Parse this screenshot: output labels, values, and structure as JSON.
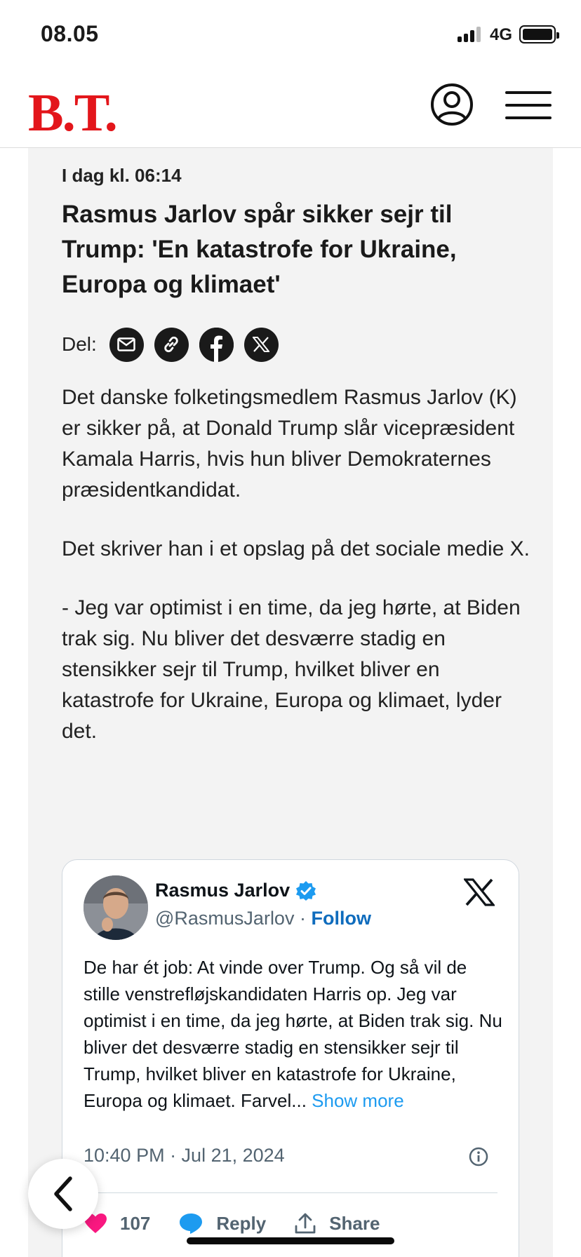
{
  "status_bar": {
    "time": "08.05",
    "network": "4G"
  },
  "header": {
    "logo": "B.T.",
    "brand_color": "#e3161b"
  },
  "article": {
    "timestamp": "I dag kl. 06:14",
    "headline": "Rasmus Jarlov spår sikker sejr til Trump: 'En katastrofe for Ukraine, Europa og klimaet'",
    "share_label": "Del:",
    "share_icons": [
      "mail-icon",
      "link-icon",
      "facebook-icon",
      "x-icon"
    ],
    "paragraphs": [
      "Det danske folketingsmedlem Rasmus Jarlov (K) er sikker på, at Donald Trump slår vicepræsident Kamala Harris, hvis hun bliver Demokraternes præsidentkandidat.",
      "Det skriver han i et opslag på det sociale medie X.",
      "- Jeg var optimist i en time, da jeg hørte, at Biden trak sig. Nu bliver det desværre stadig en stensikker sejr til Trump, hvilket bliver en katastrofe for Ukraine, Europa og klimaet, lyder det."
    ]
  },
  "tweet": {
    "name": "Rasmus Jarlov",
    "handle": "@RasmusJarlov",
    "separator": "·",
    "follow": "Follow",
    "text": "De har ét job: At vinde over Trump. Og så vil de stille venstrefløjskandidaten Harris op. Jeg var optimist i en time, da jeg hørte, at Biden trak sig. Nu bliver det desværre stadig en stensikker sejr til Trump, hvilket bliver en katastrofe for Ukraine, Europa og klimaet. Farvel...",
    "show_more": "Show more",
    "time": "10:40 PM · Jul 21, 2024",
    "likes": "107",
    "reply": "Reply",
    "share": "Share",
    "colors": {
      "like": "#f91880",
      "reply": "#1d9bf0",
      "follow": "#0f6cbd"
    }
  }
}
